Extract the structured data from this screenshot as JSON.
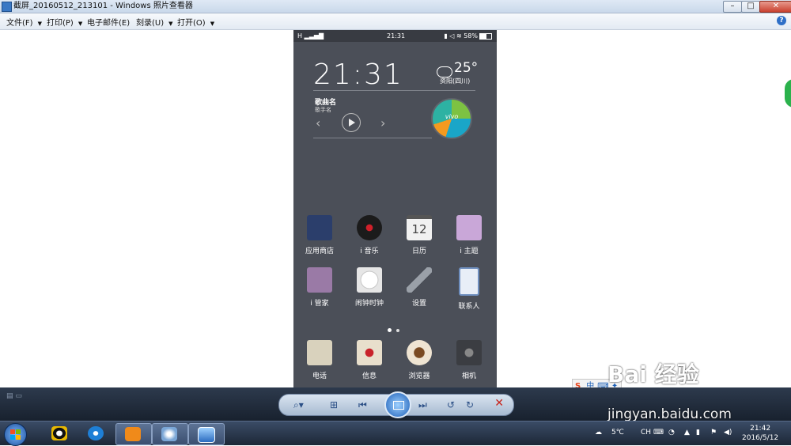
{
  "window": {
    "title": "截屏_20160512_213101 - Windows 照片查看器",
    "minimize": "–",
    "maximize": "□",
    "close": "✕"
  },
  "menubar": {
    "items": [
      {
        "label": "文件(F)"
      },
      {
        "label": "打印(P)"
      },
      {
        "label": "电子邮件(E)"
      },
      {
        "label": "刻录(U)"
      },
      {
        "label": "打开(O)"
      }
    ],
    "help": "?"
  },
  "phone": {
    "status": {
      "signal": "H",
      "time": "21:31",
      "battery": "58%"
    },
    "widget": {
      "clock": "21:31",
      "temperature": "25°",
      "city": "资阳(四川)",
      "song_title": "歌曲名",
      "singer": "歌手名",
      "prev": "‹",
      "next": "›",
      "brand": "vivo"
    },
    "apps_row1": [
      {
        "label": "应用商店",
        "icon": "app-store-icon",
        "color": "#2b3e6b"
      },
      {
        "label": "i 音乐",
        "icon": "music-record-icon",
        "color": "#1b1b1b"
      },
      {
        "label": "日历",
        "icon": "calendar-icon",
        "color": "#f1f1f1"
      },
      {
        "label": "i 主题",
        "icon": "theme-shirt-icon",
        "color": "#c9a7d8"
      }
    ],
    "calendar_day": "12",
    "apps_row2": [
      {
        "label": "i 管家",
        "icon": "manager-case-icon",
        "color": "#9a7aa6"
      },
      {
        "label": "闹钟时钟",
        "icon": "alarm-clock-icon",
        "color": "#e6e6e6"
      },
      {
        "label": "设置",
        "icon": "wrench-settings-icon",
        "color": "#9aa0a8"
      },
      {
        "label": "联系人",
        "icon": "contacts-icon",
        "color": "#6f8fbf"
      }
    ],
    "dock": [
      {
        "label": "电话",
        "icon": "phone-icon",
        "color": "#d9d2bd"
      },
      {
        "label": "信息",
        "icon": "message-envelope-icon",
        "color": "#e8dfcc"
      },
      {
        "label": "浏览器",
        "icon": "browser-coffee-icon",
        "color": "#efe4d2"
      },
      {
        "label": "相机",
        "icon": "camera-icon",
        "color": "#3b3d42"
      }
    ]
  },
  "ime": {
    "logo": "S",
    "mode": "中",
    "extra": "⌨ ✦"
  },
  "watermark": {
    "line1": "Bai  经验",
    "line2": "jingyan.baidu.com"
  },
  "viewer": {
    "buttons": [
      "zoom",
      "fit",
      "prev",
      "slideshow",
      "next",
      "rotate-left",
      "rotate-right",
      "delete"
    ],
    "delete": "✕"
  },
  "taskbar": {
    "weather": "5℃",
    "lang": "CH",
    "time": "21:42",
    "date": "2016/5/12"
  }
}
